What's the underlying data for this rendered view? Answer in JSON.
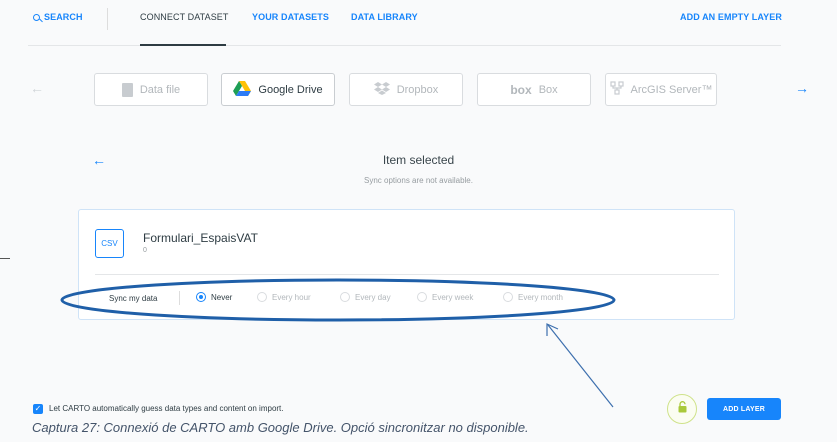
{
  "nav": {
    "search": "SEARCH",
    "connect_dataset": "CONNECT DATASET",
    "your_datasets": "YOUR DATASETS",
    "data_library": "DATA LIBRARY",
    "add_empty_layer": "ADD AN EMPTY LAYER"
  },
  "sources": [
    {
      "label": "Data file",
      "icon": "file-icon"
    },
    {
      "label": "Google Drive",
      "icon": "google-drive-icon"
    },
    {
      "label": "Dropbox",
      "icon": "dropbox-icon"
    },
    {
      "label": "Box",
      "icon": "box-icon",
      "logo": "box"
    },
    {
      "label": "ArcGIS Server™",
      "icon": "arcgis-icon"
    }
  ],
  "selected_source": "Google Drive",
  "item": {
    "title": "Item selected",
    "subtitle": "Sync options are not available."
  },
  "file": {
    "badge": "CSV",
    "name": "Formulari_EspaisVAT",
    "size": "0"
  },
  "sync": {
    "label": "Sync my data",
    "selected": "Never",
    "options": [
      "Never",
      "Every hour",
      "Every day",
      "Every week",
      "Every month"
    ]
  },
  "footer": {
    "guess_label": "Let CARTO automatically guess data types and content on import.",
    "guess_checked": true,
    "add_layer": "ADD LAYER"
  },
  "caption": "Captura 27: Connexió de CARTO amb Google Drive. Opció sincronitzar no disponible.",
  "colors": {
    "accent": "#1785fb",
    "text": "#2e3c43",
    "muted": "#b2b7bb",
    "annotation": "#1f5fa8"
  }
}
